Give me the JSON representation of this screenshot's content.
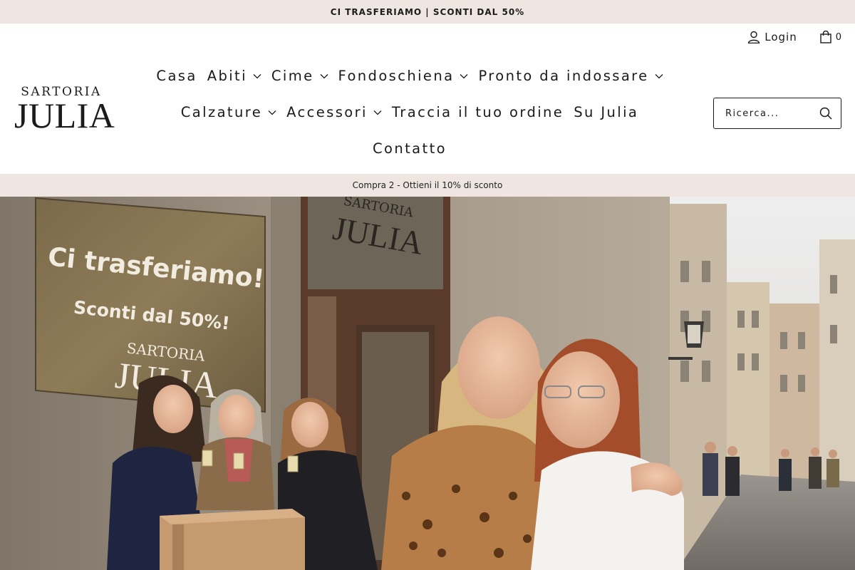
{
  "announcement": "CI TRASFERIAMO | SCONTI DAL 50%",
  "header": {
    "login_label": "Login",
    "cart_count": "0",
    "logo": {
      "top": "SARTORIA",
      "main": "JULIA"
    },
    "nav": [
      {
        "label": "Casa",
        "dropdown": false
      },
      {
        "label": "Abiti",
        "dropdown": true
      },
      {
        "label": "Cime",
        "dropdown": true
      },
      {
        "label": "Fondoschiena",
        "dropdown": true
      },
      {
        "label": "Pronto da indossare",
        "dropdown": true
      },
      {
        "label": "Calzature",
        "dropdown": true
      },
      {
        "label": "Accessori",
        "dropdown": true
      },
      {
        "label": "Traccia il tuo ordine",
        "dropdown": false
      },
      {
        "label": "Su Julia",
        "dropdown": false
      },
      {
        "label": "Contatto",
        "dropdown": false
      }
    ],
    "search_placeholder": "Ricerca..."
  },
  "promo": "Compra 2 - Ottieni il 10% di sconto",
  "hero": {
    "plaque_line1": "Ci trasferiamo!",
    "plaque_line2": "Sconti dal 50%!",
    "plaque_brand_top": "SARTORIA",
    "plaque_brand_main": "JULIA",
    "window_brand_top": "SARTORIA",
    "window_brand_main": "JULIA"
  },
  "colors": {
    "beige_bar": "#efe6e1",
    "text": "#1a1a1a"
  },
  "icons": {
    "login": "user-icon",
    "cart": "shopping-bag-icon",
    "search": "search-icon",
    "dropdown": "chevron-down-icon"
  }
}
